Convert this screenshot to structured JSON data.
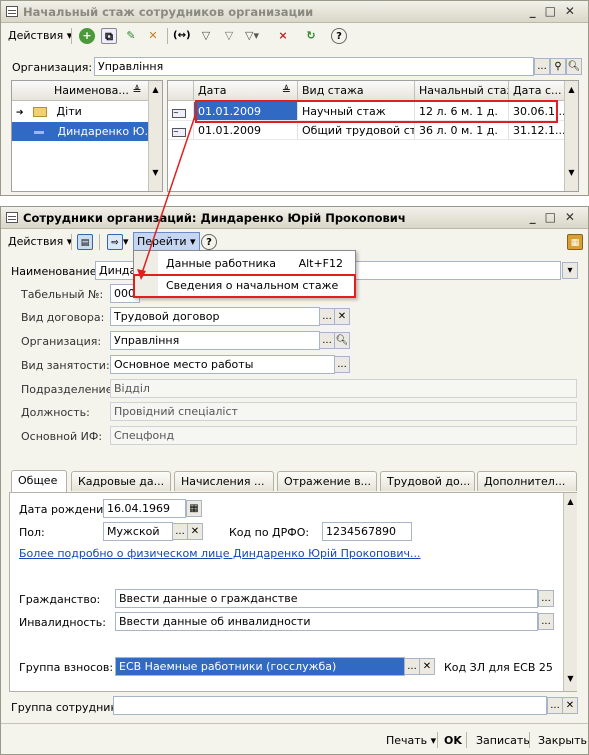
{
  "list_window": {
    "title": "Начальный стаж сотрудников организации",
    "toolbar": {
      "actions_label": "Действия",
      "help": "?"
    },
    "org_label": "Организация:",
    "org_value": "Управління",
    "tree": {
      "header": "Наименова...",
      "items": [
        {
          "label": "Діти"
        },
        {
          "label": "Диндаренко Ю..."
        }
      ]
    },
    "table": {
      "columns": [
        "Дата",
        "Вид стажа",
        "Начальный стаж",
        "Дата с..."
      ],
      "rows": [
        [
          "01.01.2009",
          "Научный стаж",
          "12 л. 6 м. 1 д.",
          "30.06.1..."
        ],
        [
          "01.01.2009",
          "Общий трудовой ст...",
          "36 л. 0 м. 1 д.",
          "31.12.1..."
        ]
      ]
    }
  },
  "form_window": {
    "title": "Сотрудники организаций: Диндаренко Юрій Прокопович",
    "toolbar": {
      "actions_label": "Действия",
      "goto_label": "Перейти",
      "help": "?"
    },
    "menu": {
      "items": [
        {
          "label": "Данные работника",
          "shortcut": "Alt+F12"
        },
        {
          "label": "Сведения о начальном стаже",
          "shortcut": ""
        }
      ]
    },
    "fields": {
      "name_label": "Наименование:",
      "name_value": "Диндаре",
      "tab_no_label": "Табельный №:",
      "tab_no_value": "0000",
      "contract_label": "Вид договора:",
      "contract_value": "Трудовой договор",
      "org_label": "Организация:",
      "org_value": "Управління",
      "employment_label": "Вид занятости:",
      "employment_value": "Основное место работы",
      "dept_label": "Подразделение:",
      "dept_value": "Відділ",
      "position_label": "Должность:",
      "position_value": "Провідний спеціаліст",
      "fund_label": "Основной ИФ:",
      "fund_value": "Спецфонд"
    },
    "tabs": [
      "Общее",
      "Кадровые да...",
      "Начисления ...",
      "Отражение в...",
      "Трудовой до...",
      "Дополнител..."
    ],
    "general": {
      "birth_label": "Дата рождения:",
      "birth_value": "16.04.1969",
      "sex_label": "Пол:",
      "sex_value": "Мужской",
      "inn_label": "Код по ДРФО:",
      "inn_value": "1234567890",
      "more_link": "Более подробно о физическом лице Диндаренко Юрій Прокопович...",
      "citizenship_label": "Гражданство:",
      "citizenship_value": "Ввести данные о гражданстве",
      "disability_label": "Инвалидность:",
      "disability_value": "Ввести данные об инвалидности",
      "contrib_label": "Группа взносов:",
      "contrib_value": "ЕСВ Наемные работники (госслужба)",
      "zl_code": "Код ЗЛ для ЕСВ 25"
    },
    "group_label": "Группа сотрудника:",
    "bottom": {
      "print": "Печать",
      "ok": "OK",
      "save": "Записать",
      "close": "Закрыть"
    }
  },
  "colors": {
    "highlight": "#e02020",
    "selection": "#316ac5",
    "title_bg": "#e6e4d8"
  }
}
